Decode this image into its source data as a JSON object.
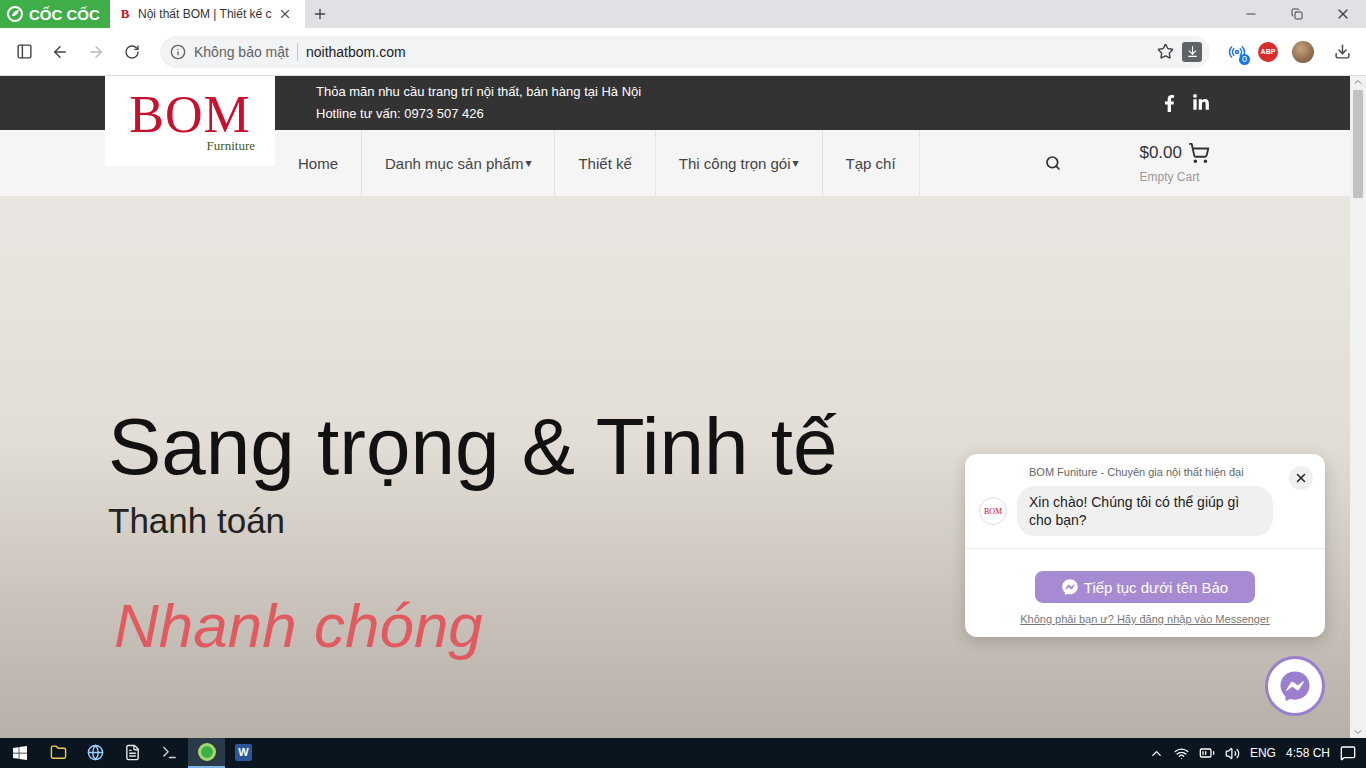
{
  "browser": {
    "brand": "CỐC CỐC",
    "tab": {
      "favicon": "B",
      "title": "Nội thất BOM | Thiết kế c",
      "selected": true
    },
    "address": {
      "security": "Không bảo mật",
      "url": "noithatbom.com"
    },
    "extensions": [
      {
        "label": "0",
        "kind": "badge"
      },
      {
        "label": "ABP",
        "kind": "adblock"
      }
    ]
  },
  "site": {
    "logo": {
      "mark": "BOM",
      "sub": "Furniture"
    },
    "tagline": "Thỏa mãn nhu cầu trang trí nội thất, bán hàng tại Hà Nội",
    "hotline": "Hotline tư vấn: 0973 507 426",
    "nav_caret": "▾",
    "nav": [
      {
        "label": "Home",
        "dropdown": false
      },
      {
        "label": "Danh mục sản phẩm",
        "dropdown": true
      },
      {
        "label": "Thiết kế",
        "dropdown": false
      },
      {
        "label": "Thi công trọn gói",
        "dropdown": true
      },
      {
        "label": "Tạp chí",
        "dropdown": false
      }
    ],
    "cart": {
      "total": "$0.00",
      "status": "Empty Cart"
    },
    "hero": {
      "title": "Sang trọng & Tinh tế",
      "subtitle": "Thanh toán",
      "accent": "Nhanh chóng"
    },
    "chat": {
      "page": "BOM Funiture - Chuyên gia nội thất hiện đại",
      "avatar": "BOM",
      "message": "Xin chào! Chúng tôi có thể giúp gì cho bạn?",
      "button": "Tiếp tục dưới tên Bảo",
      "link": "Không phải bạn ư? Hãy đăng nhập vào Messenger"
    }
  },
  "taskbar": {
    "apps": [
      {
        "kind": "explorer",
        "active": false
      },
      {
        "kind": "paint",
        "active": false
      },
      {
        "kind": "notepad",
        "active": false
      },
      {
        "kind": "terminal",
        "active": false
      },
      {
        "kind": "coccoc",
        "active": true
      },
      {
        "kind": "word",
        "label": "W",
        "active": false
      }
    ],
    "language": "ENG",
    "time": "4:58 CH"
  }
}
